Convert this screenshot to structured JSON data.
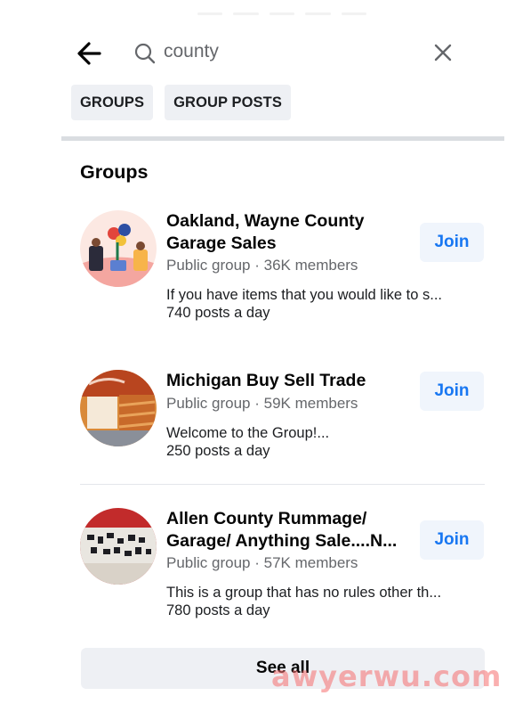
{
  "search": {
    "query": "county"
  },
  "filters": [
    {
      "label": "GROUPS"
    },
    {
      "label": "GROUP POSTS"
    }
  ],
  "section": {
    "title": "Groups"
  },
  "groups": [
    {
      "name": "Oakland, Wayne County Garage Sales",
      "meta": "Public group · 36K members",
      "description": "If you have items that you would like to s...",
      "activity": "740 posts a day",
      "action_label": "Join"
    },
    {
      "name": "Michigan Buy Sell Trade",
      "meta": "Public group · 59K members",
      "description": "Welcome to the Group!...",
      "activity": "250 posts a day",
      "action_label": "Join"
    },
    {
      "name": "Allen County Rummage/ Garage/ Anything Sale....N...",
      "meta": "Public group · 57K members",
      "description": "This is a group that has no rules other th...",
      "activity": "780 posts a day",
      "action_label": "Join"
    }
  ],
  "footer": {
    "see_all_label": "See all"
  },
  "watermark": "awyerwu.com",
  "colors": {
    "accent": "#1877f2",
    "chip_bg": "#eef0f4",
    "join_bg": "#f0f5fc",
    "secondary_text": "#65676b"
  },
  "icons": {
    "back": "arrow-left-icon",
    "search": "search-icon",
    "clear": "close-icon"
  }
}
